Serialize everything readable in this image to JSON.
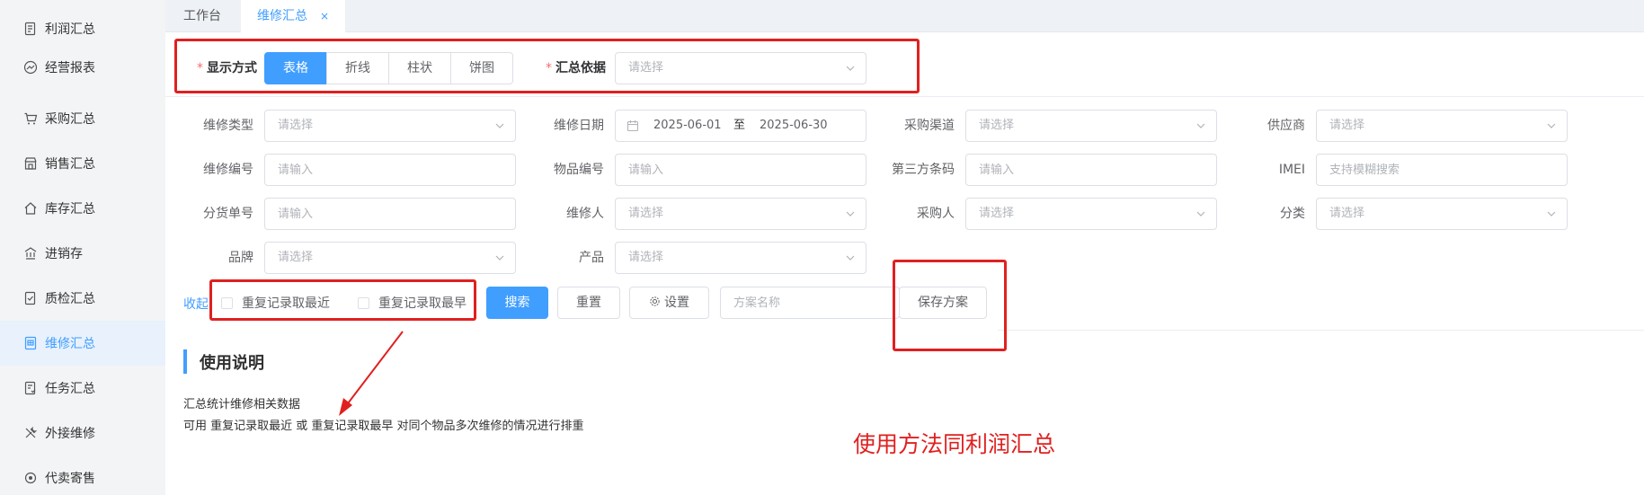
{
  "sidebar": {
    "items": [
      {
        "label": "利润汇总",
        "icon": "report-icon"
      },
      {
        "label": "经营报表",
        "icon": "trend-icon"
      },
      {
        "label": "采购汇总",
        "icon": "cart-icon"
      },
      {
        "label": "销售汇总",
        "icon": "shop-icon"
      },
      {
        "label": "库存汇总",
        "icon": "home-icon"
      },
      {
        "label": "进销存",
        "icon": "bank-icon"
      },
      {
        "label": "质检汇总",
        "icon": "doc-check-icon"
      },
      {
        "label": "维修汇总",
        "icon": "grid-doc-icon"
      },
      {
        "label": "任务汇总",
        "icon": "task-icon"
      },
      {
        "label": "外接维修",
        "icon": "tools-icon"
      },
      {
        "label": "代卖寄售",
        "icon": "circle-icon"
      }
    ],
    "active_index": 7
  },
  "tabs": {
    "items": [
      {
        "label": "工作台"
      },
      {
        "label": "维修汇总"
      }
    ],
    "close_glyph": "×"
  },
  "display": {
    "required_mark": "*",
    "label": "显示方式",
    "options": [
      "表格",
      "折线",
      "柱状",
      "饼图"
    ],
    "selected": "表格",
    "basis_label": "汇总依据",
    "basis_placeholder": "请选择"
  },
  "filters": {
    "repair_type": {
      "label": "维修类型",
      "placeholder": "请选择"
    },
    "repair_date": {
      "label": "维修日期",
      "start": "2025-06-01",
      "separator": "至",
      "end": "2025-06-30"
    },
    "purchase_channel": {
      "label": "采购渠道",
      "placeholder": "请选择"
    },
    "supplier": {
      "label": "供应商",
      "placeholder": "请选择"
    },
    "repair_no": {
      "label": "维修编号",
      "placeholder": "请输入"
    },
    "item_no": {
      "label": "物品编号",
      "placeholder": "请输入"
    },
    "third_party_code": {
      "label": "第三方条码",
      "placeholder": "请输入"
    },
    "imei": {
      "label": "IMEI",
      "placeholder": "支持模糊搜索"
    },
    "sub_order_no": {
      "label": "分货单号",
      "placeholder": "请输入"
    },
    "repairer": {
      "label": "维修人",
      "placeholder": "请选择"
    },
    "purchaser": {
      "label": "采购人",
      "placeholder": "请选择"
    },
    "category": {
      "label": "分类",
      "placeholder": "请选择"
    },
    "brand": {
      "label": "品牌",
      "placeholder": "请选择"
    },
    "product": {
      "label": "产品",
      "placeholder": "请选择"
    }
  },
  "actions": {
    "collapse": "收起",
    "dedup_latest": "重复记录取最近",
    "dedup_earliest": "重复记录取最早",
    "search": "搜索",
    "reset": "重置",
    "settings": "设置",
    "plan_name_placeholder": "方案名称",
    "save_plan": "保存方案"
  },
  "usage": {
    "title": "使用说明",
    "line1": "汇总统计维修相关数据",
    "line2": "可用 重复记录取最近 或 重复记录取最早 对同个物品多次维修的情况进行排重"
  },
  "annotation": {
    "text": "使用方法同利润汇总",
    "color": "#e02020"
  },
  "colors": {
    "accent": "#409eff",
    "required": "#f56c6c"
  }
}
